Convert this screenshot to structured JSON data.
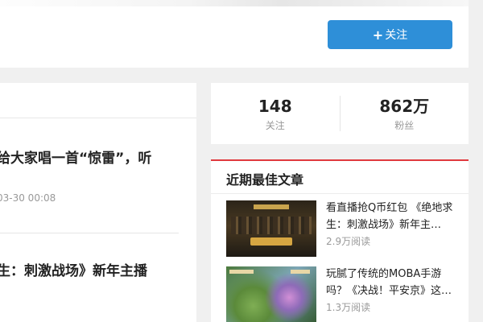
{
  "header": {
    "follow_label": "关注",
    "follow_plus": "+"
  },
  "articles": [
    {
      "title": "给大家唱一首“惊雷”，听",
      "date": "03-30 00:08"
    },
    {
      "title": "生：刺激战场》新年主播",
      "date": ""
    }
  ],
  "stats": {
    "following_count": "148",
    "following_label": "关注",
    "fans_count": "862万",
    "fans_label": "粉丝"
  },
  "best_articles": {
    "title": "近期最佳文章",
    "items": [
      {
        "title": "看直播抢Q币红包 《绝地求生：刺激战场》新年主…",
        "reads": "2.9万阅读"
      },
      {
        "title": "玩腻了传统的MOBA手游吗？《决战！平安京》这…",
        "reads": "1.3万阅读"
      }
    ]
  },
  "colors": {
    "accent_blue": "#2e8fd8",
    "accent_red": "#e0393e"
  }
}
